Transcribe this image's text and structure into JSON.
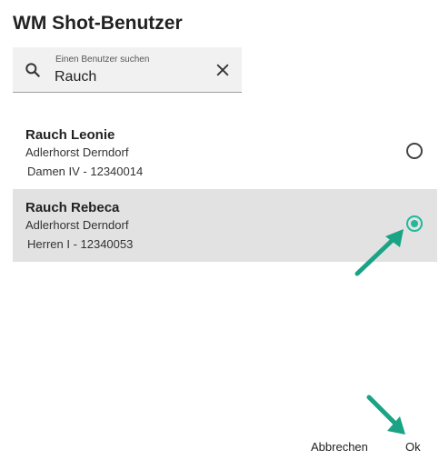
{
  "dialog": {
    "title": "WM Shot-Benutzer"
  },
  "search": {
    "placeholder": "Einen Benutzer suchen",
    "value": "Rauch"
  },
  "results": [
    {
      "name": "Rauch Leonie",
      "club": "Adlerhorst Derndorf",
      "team": "Damen IV  - 12340014",
      "selected": false
    },
    {
      "name": "Rauch Rebeca",
      "club": "Adlerhorst Derndorf",
      "team": "Herren I  - 12340053",
      "selected": true
    }
  ],
  "actions": {
    "cancel_label": "Abbrechen",
    "ok_label": "Ok"
  },
  "colors": {
    "accent": "#21b89c",
    "annotation_arrow": "#1aa385",
    "selected_row_bg": "#e2e2e2"
  },
  "icons": {
    "search": "search-icon",
    "clear": "close-icon"
  }
}
